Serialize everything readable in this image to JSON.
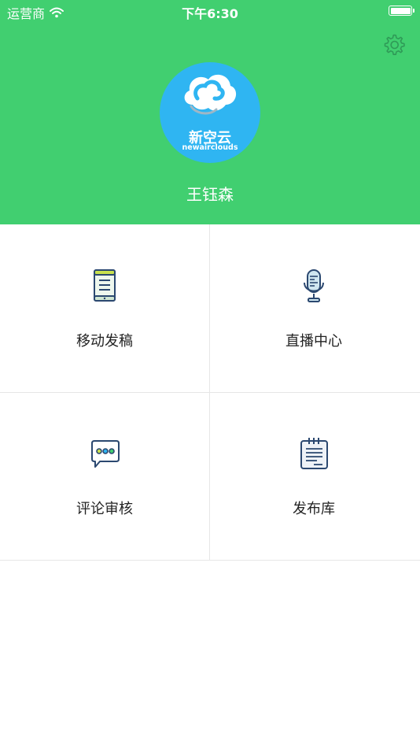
{
  "status_bar": {
    "carrier": "运营商",
    "time": "下午6:30"
  },
  "header": {
    "background_color": "#41cf70",
    "logo": {
      "name_cn": "新空云",
      "name_en": "newairclouds",
      "color": "#2fb5f2"
    },
    "username": "王钰森",
    "settings_icon": "gear-icon"
  },
  "menu": {
    "items": [
      {
        "label": "移动发稿",
        "icon": "mobile-phone-icon"
      },
      {
        "label": "直播中心",
        "icon": "microphone-icon"
      },
      {
        "label": "评论审核",
        "icon": "chat-bubble-icon"
      },
      {
        "label": "发布库",
        "icon": "notepad-icon"
      }
    ]
  }
}
